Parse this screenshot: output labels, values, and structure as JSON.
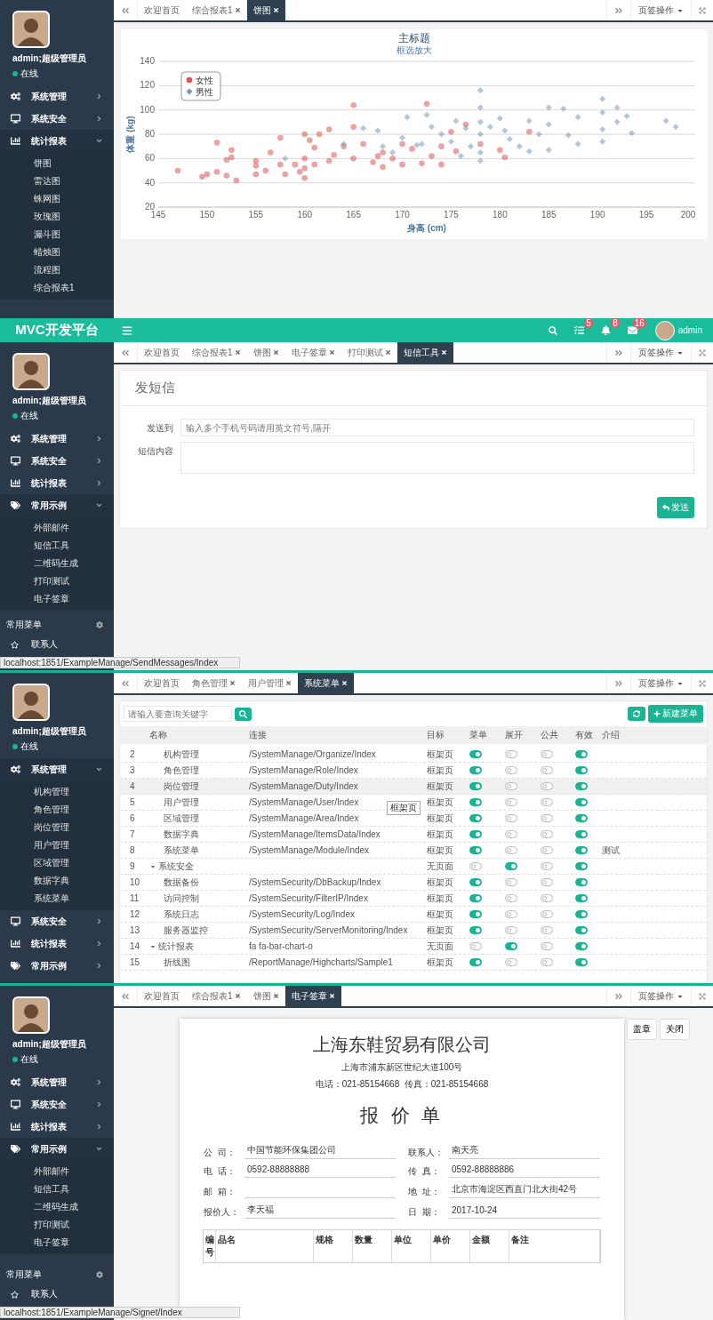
{
  "panels": [
    {
      "kind": "chart",
      "sidebar": {
        "user": "admin;超级管理员",
        "status": "在线",
        "menu": [
          {
            "label": "系统管理",
            "expanded": false
          },
          {
            "label": "系统安全",
            "expanded": false
          },
          {
            "label": "统计报表",
            "expanded": true,
            "children": [
              {
                "label": "饼图"
              },
              {
                "label": "雷达图"
              },
              {
                "label": "蛛网图"
              },
              {
                "label": "玫瑰图"
              },
              {
                "label": "漏斗图"
              },
              {
                "label": "蜡烛图"
              },
              {
                "label": "流程图"
              },
              {
                "label": "综合报表1"
              }
            ]
          }
        ]
      },
      "tabs": [
        {
          "label": "欢迎首页",
          "closable": false,
          "selected": false
        },
        {
          "label": "综合报表1",
          "closable": true,
          "selected": false
        },
        {
          "label": "饼图",
          "closable": true,
          "selected": true
        }
      ],
      "tab_actions": "页签操作",
      "chart": {
        "subtitle": "框选放大",
        "chart_data": {
          "type": "scatter",
          "title": "主标题",
          "xlabel": "身高 (cm)",
          "ylabel": "体重 (kg)",
          "xlim": [
            145,
            200
          ],
          "ylim": [
            20,
            140
          ],
          "xticks": [
            145,
            150,
            155,
            160,
            165,
            170,
            175,
            180,
            185,
            190,
            195,
            200
          ],
          "yticks": [
            20,
            40,
            60,
            80,
            100,
            120,
            140
          ],
          "grid": true,
          "legend": true,
          "x": [
            147,
            149.5,
            150,
            151,
            151,
            152,
            152,
            152.5,
            152.5,
            153,
            155,
            155,
            155,
            156,
            156.5,
            157.5,
            157.5,
            158,
            159,
            159.5,
            160,
            160,
            160,
            160,
            160.5,
            161,
            161,
            161.5,
            162.5,
            162.5,
            163,
            164,
            165,
            165,
            165,
            166,
            167,
            167.5,
            168,
            168,
            169,
            170,
            170,
            171,
            172,
            172.5,
            173,
            174,
            174,
            175,
            175.5,
            176.5,
            178,
            180,
            180.5,
            183,
            158,
            164,
            166,
            167.5,
            168,
            169,
            170,
            170.5,
            171.5,
            172,
            172.5,
            173,
            174,
            175,
            175.5,
            176,
            176.5,
            177,
            178,
            178,
            178,
            178,
            178,
            178,
            179,
            180,
            180.5,
            181,
            182,
            183,
            183,
            184,
            185,
            185,
            185,
            186.5,
            187,
            188,
            188,
            190.5,
            190.5,
            190.5,
            190.5,
            192,
            192,
            193,
            193.5,
            197,
            198
          ],
          "series": [
            {
              "name": "女性",
              "color": "#df5353",
              "values": [
                50,
                45,
                47,
                49,
                73,
                46,
                59,
                61,
                67,
                42,
                47,
                54,
                58,
                50,
                65,
                77,
                55,
                47,
                55,
                49,
                44,
                52,
                60,
                80,
                75,
                55,
                69,
                80,
                58,
                84,
                63,
                70,
                104,
                60,
                86,
                72,
                57,
                62,
                53,
                65,
                60,
                55,
                72,
                68,
                56,
                105,
                62,
                55,
                70,
                82,
                66,
                88,
                72,
                67,
                61,
                82,
                null,
                null,
                null,
                null,
                null,
                null,
                null,
                null,
                null,
                null,
                null,
                null,
                null,
                null,
                null,
                null,
                null,
                null,
                null,
                null,
                null,
                null,
                null,
                null,
                null,
                null,
                null,
                null,
                null,
                null,
                null,
                null,
                null,
                null,
                null,
                null,
                null,
                null,
                null,
                null,
                null,
                null,
                null,
                null,
                null,
                null,
                null,
                null,
                null
              ]
            },
            {
              "name": "男性",
              "color": "#7798bf",
              "values": [
                null,
                null,
                null,
                null,
                null,
                null,
                null,
                null,
                null,
                null,
                null,
                null,
                null,
                null,
                null,
                null,
                null,
                null,
                null,
                null,
                null,
                null,
                null,
                null,
                null,
                null,
                null,
                null,
                null,
                null,
                null,
                null,
                null,
                null,
                null,
                null,
                null,
                null,
                null,
                null,
                null,
                null,
                null,
                null,
                null,
                null,
                null,
                null,
                null,
                null,
                null,
                null,
                null,
                null,
                null,
                null,
                60,
                72,
                85,
                83,
                70,
                65,
                77,
                94,
                71,
                72,
                96,
                86,
                80,
                74,
                91,
                62,
                85,
                70,
                116,
                102,
                90,
                80,
                65,
                58,
                86,
                93,
                83,
                76,
                70,
                91,
                66,
                80,
                102,
                88,
                67,
                101,
                79,
                94,
                72,
                109,
                98,
                84,
                74,
                102,
                90,
                95,
                81,
                91,
                86
              ]
            }
          ]
        }
      }
    },
    {
      "kind": "form",
      "header": {
        "brand": "MVC开发平台",
        "badges": [
          "5",
          "8",
          "16"
        ],
        "user": "admin"
      },
      "sidebar": {
        "user": "admin;超级管理员",
        "status": "在线",
        "menu": [
          {
            "label": "系统管理",
            "expanded": false
          },
          {
            "label": "系统安全",
            "expanded": false
          },
          {
            "label": "统计报表",
            "expanded": false
          },
          {
            "label": "常用示例",
            "expanded": true,
            "children": [
              {
                "label": "外部邮件"
              },
              {
                "label": "短信工具"
              },
              {
                "label": "二维码生成"
              },
              {
                "label": "打印测试"
              },
              {
                "label": "电子签章"
              }
            ]
          }
        ],
        "footer": {
          "title": "常用菜单",
          "items": [
            {
              "label": "联系人"
            }
          ]
        }
      },
      "status_url": "localhost:1851/ExampleManage/SendMessages/Index",
      "tabs": [
        {
          "label": "欢迎首页",
          "closable": false,
          "selected": false
        },
        {
          "label": "综合报表1",
          "closable": true,
          "selected": false
        },
        {
          "label": "饼图",
          "closable": true,
          "selected": false
        },
        {
          "label": "电子签章",
          "closable": true,
          "selected": false
        },
        {
          "label": "打印测试",
          "closable": true,
          "selected": false
        },
        {
          "label": "短信工具",
          "closable": true,
          "selected": true
        }
      ],
      "tab_actions": "页签操作",
      "form": {
        "title": "发短信",
        "fields": [
          {
            "label": "发送到",
            "kind": "input",
            "placeholder": "输入多个手机号码请用英文符号,隔开"
          },
          {
            "label": "短信内容",
            "kind": "textarea"
          }
        ],
        "submit": "发送"
      }
    },
    {
      "kind": "table",
      "sidebar": {
        "user": "admin;超级管理员",
        "status": "在线",
        "menu": [
          {
            "label": "系统管理",
            "expanded": true,
            "children": [
              {
                "label": "机构管理"
              },
              {
                "label": "角色管理"
              },
              {
                "label": "岗位管理"
              },
              {
                "label": "用户管理"
              },
              {
                "label": "区域管理"
              },
              {
                "label": "数据字典"
              },
              {
                "label": "系统菜单"
              }
            ]
          },
          {
            "label": "系统安全",
            "expanded": false
          },
          {
            "label": "统计报表",
            "expanded": false
          },
          {
            "label": "常用示例",
            "expanded": false
          }
        ]
      },
      "tabs": [
        {
          "label": "欢迎首页",
          "closable": false,
          "selected": false
        },
        {
          "label": "角色管理",
          "closable": true,
          "selected": false
        },
        {
          "label": "用户管理",
          "closable": true,
          "selected": false
        },
        {
          "label": "系统菜单",
          "closable": true,
          "selected": true
        }
      ],
      "tab_actions": "页签操作",
      "table": {
        "search_placeholder": "请输入要查询关键字",
        "new_button": "新建菜单",
        "tooltip": "框架页",
        "columns": [
          "名称",
          "连接",
          "目标",
          "菜单",
          "展开",
          "公共",
          "有效",
          "介绍"
        ],
        "rows": [
          {
            "kind": "item",
            "number": "2",
            "name": "机构管理",
            "link": "/SystemManage/Organize/Index",
            "target": "框架页",
            "menu": true,
            "expand": false,
            "public": false,
            "valid": true,
            "selected": false
          },
          {
            "kind": "item",
            "number": "3",
            "name": "角色管理",
            "link": "/SystemManage/Role/Index",
            "target": "框架页",
            "menu": true,
            "expand": false,
            "public": false,
            "valid": true,
            "selected": false
          },
          {
            "kind": "item",
            "number": "4",
            "name": "岗位管理",
            "link": "/SystemManage/Duty/Index",
            "target": "框架页",
            "menu": true,
            "expand": false,
            "public": false,
            "valid": true,
            "selected": true
          },
          {
            "kind": "item",
            "number": "5",
            "name": "用户管理",
            "link": "/SystemManage/User/Index",
            "target": "框架页",
            "menu": true,
            "expand": false,
            "public": false,
            "valid": true,
            "selected": false
          },
          {
            "kind": "item",
            "number": "6",
            "name": "区域管理",
            "link": "/SystemManage/Area/Index",
            "target": "框架页",
            "menu": true,
            "expand": false,
            "public": false,
            "valid": true,
            "selected": false
          },
          {
            "kind": "item",
            "number": "7",
            "name": "数据字典",
            "link": "/SystemManage/ItemsData/Index",
            "target": "框架页",
            "menu": true,
            "expand": false,
            "public": false,
            "valid": true,
            "selected": false
          },
          {
            "kind": "item",
            "number": "8",
            "name": "系统菜单",
            "link": "/SystemManage/Module/Index",
            "target": "框架页",
            "menu": true,
            "expand": false,
            "public": false,
            "valid": true,
            "note": "测试",
            "selected": false
          },
          {
            "kind": "group",
            "number": "9",
            "name": "系统安全",
            "target": "无页面",
            "menu": false,
            "expand": true,
            "public": false,
            "valid": true,
            "expanded": true,
            "selected": false,
            "children": [
              {
                "kind": "item",
                "number": "10",
                "name": "数据备份",
                "link": "/SystemSecurity/DbBackup/Index",
                "target": "框架页",
                "menu": true,
                "expand": false,
                "public": false,
                "valid": true,
                "selected": false
              },
              {
                "kind": "item",
                "number": "11",
                "name": "访问控制",
                "link": "/SystemSecurity/FilterIP/Index",
                "target": "框架页",
                "menu": true,
                "expand": false,
                "public": false,
                "valid": true,
                "selected": false
              },
              {
                "kind": "item",
                "number": "12",
                "name": "系统日志",
                "link": "/SystemSecurity/Log/Index",
                "target": "框架页",
                "menu": true,
                "expand": false,
                "public": false,
                "valid": true,
                "selected": false
              },
              {
                "kind": "item",
                "number": "13",
                "name": "服务器监控",
                "link": "/SystemSecurity/ServerMonitoring/Index",
                "target": "框架页",
                "menu": true,
                "expand": false,
                "public": false,
                "valid": true,
                "selected": false
              }
            ]
          },
          {
            "kind": "group",
            "number": "14",
            "name": "统计报表",
            "link": "fa fa-bar-chart-o",
            "target": "无页面",
            "menu": false,
            "expand": true,
            "public": false,
            "valid": true,
            "expanded": true,
            "selected": false,
            "children": [
              {
                "kind": "item",
                "number": "15",
                "name": "折线图",
                "link": "/ReportManage/Highcharts/Sample1",
                "target": "框架页",
                "menu": true,
                "expand": false,
                "public": false,
                "valid": true,
                "selected": false
              }
            ]
          }
        ]
      }
    },
    {
      "kind": "document",
      "sidebar": {
        "user": "admin;超级管理员",
        "status": "在线",
        "menu": [
          {
            "label": "系统管理",
            "expanded": false
          },
          {
            "label": "系统安全",
            "expanded": false
          },
          {
            "label": "统计报表",
            "expanded": false
          },
          {
            "label": "常用示例",
            "expanded": true,
            "children": [
              {
                "label": "外部邮件"
              },
              {
                "label": "短信工具"
              },
              {
                "label": "二维码生成"
              },
              {
                "label": "打印测试"
              },
              {
                "label": "电子签章"
              }
            ]
          }
        ],
        "footer": {
          "title": "常用菜单",
          "items": [
            {
              "label": "联系人"
            }
          ]
        }
      },
      "status_url": "localhost:1851/ExampleManage/Signet/Index",
      "tabs": [
        {
          "label": "欢迎首页",
          "closable": false,
          "selected": false
        },
        {
          "label": "综合报表1",
          "closable": true,
          "selected": false
        },
        {
          "label": "饼图",
          "closable": true,
          "selected": false
        },
        {
          "label": "电子签章",
          "closable": true,
          "selected": true
        }
      ],
      "tab_actions": "页签操作",
      "document": {
        "company": "上海东鞋贸易有限公司",
        "address": "上海市浦东新区世纪大道100号",
        "phones": "电话：021-85154668  传真：021-85154668",
        "title": "报 价 单",
        "fields": [
          {
            "label": "公  司：",
            "value": "中国节能环保集团公司"
          },
          {
            "label": "联系人：",
            "value": "南天亮"
          },
          {
            "label": "电  话：",
            "value": "0592-88888888"
          },
          {
            "label": "传  真：",
            "value": "0592-88888886"
          },
          {
            "label": "邮  箱："
          },
          {
            "label": "地  址：",
            "value": "北京市海淀区西直门北大街42号"
          },
          {
            "label": "报价人：",
            "value": "李天福"
          },
          {
            "label": "日  期：",
            "value": "2017-10-24"
          }
        ],
        "columns": [
          "编号",
          "品名",
          "规格",
          "数量",
          "单位",
          "单价",
          "金额",
          "备注"
        ],
        "buttons": [
          "盖章",
          "关闭"
        ]
      }
    }
  ]
}
